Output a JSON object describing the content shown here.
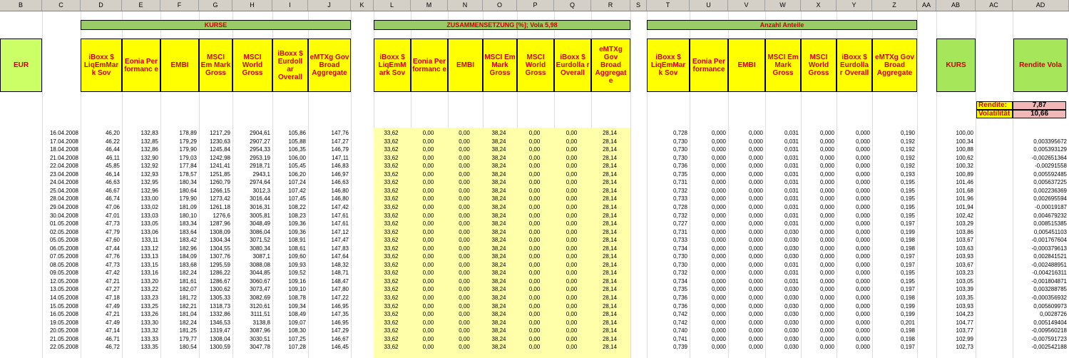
{
  "column_headers": [
    "B",
    "C",
    "D",
    "E",
    "F",
    "G",
    "H",
    "I",
    "J",
    "K",
    "L",
    "M",
    "N",
    "O",
    "P",
    "Q",
    "R",
    "S",
    "T",
    "U",
    "V",
    "W",
    "X",
    "Y",
    "Z",
    "AA",
    "AB",
    "AC",
    "AD"
  ],
  "bands": {
    "kurse": "KURSE",
    "zusammensetzung": "ZUSAMMENSETZUNG [%];   Vola 5,98",
    "anteile": "Anzahl Anteile"
  },
  "headers": {
    "eur": "EUR",
    "kurse": [
      "iBoxx $ LiqEmMar k Sov",
      "Eonia Per formanc e",
      "EMBI",
      "MSCI Em Mark Gross",
      "MSCI World Gross",
      "iBoxx $ Eurdoll ar Overall",
      "eMTXg Gov Broad Aggregate"
    ],
    "zusammensetzung": [
      "iBoxx $ LiqEmM ark Sov",
      "Eonia Per formanc e",
      "EMBI",
      "MSCI Em Mark Gross",
      "MSCI World Gross",
      "iBoxx $ Eurdolla r Overall",
      "eMTXg Gov Broad Aggregat e"
    ],
    "anteile": [
      "iBoxx $ LiqEmMar k Sov",
      "Eonia Per formance",
      "EMBI",
      "MSCI Em Mark Gross",
      "MSCI World Gross",
      "iBoxx $ Eurdolla r Overall",
      "eMTXg Gov Broad Aggregate"
    ],
    "kurs": "KURS",
    "rendite_vola": "Rendite Vola"
  },
  "summary": {
    "rendite_label": "Rendite:",
    "rendite_value": "7,87",
    "volatilitaet_label": "Volatilität",
    "volatilitaet_value": "10,66"
  },
  "rows": [
    [
      "16.04.2008",
      "46,20",
      "132,83",
      "178,89",
      "1217,29",
      "2904,61",
      "105,86",
      "147,76",
      "33,62",
      "0,00",
      "0,00",
      "38,24",
      "0,00",
      "0,00",
      "28,14",
      "0,728",
      "0,000",
      "0,000",
      "0,031",
      "0,000",
      "0,000",
      "0,190",
      "100,00",
      ""
    ],
    [
      "17.04.2008",
      "46,22",
      "132,85",
      "179,29",
      "1230,63",
      "2907,27",
      "105,88",
      "147,27",
      "33,62",
      "0,00",
      "0,00",
      "38,24",
      "0,00",
      "0,00",
      "28,14",
      "0,730",
      "0,000",
      "0,000",
      "0,031",
      "0,000",
      "0,000",
      "0,192",
      "100,34",
      "0,003395672"
    ],
    [
      "18.04.2008",
      "46,44",
      "132,86",
      "179,90",
      "1245,84",
      "2954,33",
      "106,35",
      "146,79",
      "33,62",
      "0,00",
      "0,00",
      "38,24",
      "0,00",
      "0,00",
      "28,14",
      "0,730",
      "0,000",
      "0,000",
      "0,031",
      "0,000",
      "0,000",
      "0,192",
      "100,88",
      "0,005393129"
    ],
    [
      "21.04.2008",
      "46,11",
      "132,90",
      "179,03",
      "1242,98",
      "2953,19",
      "106,00",
      "147,11",
      "33,62",
      "0,00",
      "0,00",
      "38,24",
      "0,00",
      "0,00",
      "28,14",
      "0,730",
      "0,000",
      "0,000",
      "0,031",
      "0,000",
      "0,000",
      "0,192",
      "100,62",
      "-0,002651364"
    ],
    [
      "22.04.2008",
      "45,85",
      "132,92",
      "177,84",
      "1241,41",
      "2918,71",
      "105,45",
      "146,83",
      "33,62",
      "0,00",
      "0,00",
      "38,24",
      "0,00",
      "0,00",
      "28,14",
      "0,736",
      "0,000",
      "0,000",
      "0,031",
      "0,000",
      "0,000",
      "0,192",
      "100,32",
      "-0,00291558"
    ],
    [
      "23.04.2008",
      "46,14",
      "132,93",
      "178,57",
      "1251,85",
      "2943,1",
      "106,20",
      "146,97",
      "33,62",
      "0,00",
      "0,00",
      "38,24",
      "0,00",
      "0,00",
      "28,14",
      "0,735",
      "0,000",
      "0,000",
      "0,031",
      "0,000",
      "0,000",
      "0,193",
      "100,89",
      "0,005592485"
    ],
    [
      "24.04.2008",
      "46,63",
      "132,95",
      "180,34",
      "1260,79",
      "2974,64",
      "107,24",
      "146,63",
      "33,62",
      "0,00",
      "0,00",
      "38,24",
      "0,00",
      "0,00",
      "28,14",
      "0,731",
      "0,000",
      "0,000",
      "0,031",
      "0,000",
      "0,000",
      "0,195",
      "101,46",
      "0,005637225"
    ],
    [
      "25.04.2008",
      "46,67",
      "132,96",
      "180,64",
      "1266,15",
      "3012,3",
      "107,42",
      "146,80",
      "33,62",
      "0,00",
      "0,00",
      "38,24",
      "0,00",
      "0,00",
      "28,14",
      "0,732",
      "0,000",
      "0,000",
      "0,031",
      "0,000",
      "0,000",
      "0,195",
      "101,68",
      "0,002236369"
    ],
    [
      "28.04.2008",
      "46,74",
      "133,00",
      "179,90",
      "1273,42",
      "3016,44",
      "107,45",
      "146,80",
      "33,62",
      "0,00",
      "0,00",
      "38,24",
      "0,00",
      "0,00",
      "28,14",
      "0,733",
      "0,000",
      "0,000",
      "0,031",
      "0,000",
      "0,000",
      "0,195",
      "101,96",
      "0,002695594"
    ],
    [
      "29.04.2008",
      "47,06",
      "133,02",
      "181,09",
      "1261,18",
      "3016,31",
      "108,22",
      "147,42",
      "33,62",
      "0,00",
      "0,00",
      "38,24",
      "0,00",
      "0,00",
      "28,14",
      "0,728",
      "0,000",
      "0,000",
      "0,031",
      "0,000",
      "0,000",
      "0,195",
      "101,94",
      "-0,00019187"
    ],
    [
      "30.04.2008",
      "47,01",
      "133,03",
      "180,10",
      "1276,6",
      "3005,81",
      "108,23",
      "147,61",
      "33,62",
      "0,00",
      "0,00",
      "38,24",
      "0,00",
      "0,00",
      "28,14",
      "0,732",
      "0,000",
      "0,000",
      "0,031",
      "0,000",
      "0,000",
      "0,195",
      "102,42",
      "0,004679232"
    ],
    [
      "01.05.2008",
      "47,73",
      "133,05",
      "183,34",
      "1287,96",
      "3048,49",
      "109,36",
      "147,61",
      "33,62",
      "0,00",
      "0,00",
      "38,24",
      "0,00",
      "0,00",
      "28,14",
      "0,727",
      "0,000",
      "0,000",
      "0,031",
      "0,000",
      "0,000",
      "0,197",
      "103,29",
      "0,008515385"
    ],
    [
      "02.05.2008",
      "47,79",
      "133,06",
      "183,64",
      "1308,09",
      "3086,04",
      "109,36",
      "147,12",
      "33,62",
      "0,00",
      "0,00",
      "38,24",
      "0,00",
      "0,00",
      "28,14",
      "0,731",
      "0,000",
      "0,000",
      "0,030",
      "0,000",
      "0,000",
      "0,199",
      "103,86",
      "0,005451103"
    ],
    [
      "05.05.2008",
      "47,60",
      "133,11",
      "183,42",
      "1304,34",
      "3071,52",
      "108,91",
      "147,47",
      "33,62",
      "0,00",
      "0,00",
      "38,24",
      "0,00",
      "0,00",
      "28,14",
      "0,733",
      "0,000",
      "0,000",
      "0,030",
      "0,000",
      "0,000",
      "0,198",
      "103,67",
      "-0,001767604"
    ],
    [
      "06.05.2008",
      "47,44",
      "133,12",
      "182,96",
      "1304,55",
      "3080,34",
      "108,61",
      "147,83",
      "33,62",
      "0,00",
      "0,00",
      "38,24",
      "0,00",
      "0,00",
      "28,14",
      "0,734",
      "0,000",
      "0,000",
      "0,030",
      "0,000",
      "0,000",
      "0,198",
      "103,63",
      "-0,000379613"
    ],
    [
      "07.05.2008",
      "47,76",
      "133,13",
      "184,09",
      "1307,76",
      "3087,1",
      "109,60",
      "147,64",
      "33,62",
      "0,00",
      "0,00",
      "38,24",
      "0,00",
      "0,00",
      "28,14",
      "0,730",
      "0,000",
      "0,000",
      "0,030",
      "0,000",
      "0,000",
      "0,197",
      "103,93",
      "0,002841521"
    ],
    [
      "08.05.2008",
      "47,73",
      "133,15",
      "183,68",
      "1295,59",
      "3088,08",
      "109,93",
      "148,32",
      "33,62",
      "0,00",
      "0,00",
      "38,24",
      "0,00",
      "0,00",
      "28,14",
      "0,730",
      "0,000",
      "0,000",
      "0,031",
      "0,000",
      "0,000",
      "0,197",
      "103,67",
      "-0,002488951"
    ],
    [
      "09.05.2008",
      "47,42",
      "133,16",
      "182,24",
      "1286,22",
      "3044,85",
      "109,52",
      "148,71",
      "33,62",
      "0,00",
      "0,00",
      "38,24",
      "0,00",
      "0,00",
      "28,14",
      "0,732",
      "0,000",
      "0,000",
      "0,031",
      "0,000",
      "0,000",
      "0,195",
      "103,23",
      "-0,004216311"
    ],
    [
      "12.05.2008",
      "47,21",
      "133,20",
      "181,61",
      "1286,67",
      "3060,67",
      "109,16",
      "148,47",
      "33,62",
      "0,00",
      "0,00",
      "38,24",
      "0,00",
      "0,00",
      "28,14",
      "0,734",
      "0,000",
      "0,000",
      "0,031",
      "0,000",
      "0,000",
      "0,195",
      "103,05",
      "-0,001804871"
    ],
    [
      "13.05.2008",
      "47,27",
      "133,22",
      "182,07",
      "1300,62",
      "3073,47",
      "109,10",
      "147,80",
      "33,62",
      "0,00",
      "0,00",
      "38,24",
      "0,00",
      "0,00",
      "28,14",
      "0,735",
      "0,000",
      "0,000",
      "0,030",
      "0,000",
      "0,000",
      "0,197",
      "103,39",
      "0,003288785"
    ],
    [
      "14.05.2008",
      "47,18",
      "133,23",
      "181,72",
      "1305,33",
      "3082,69",
      "108,78",
      "147,22",
      "33,62",
      "0,00",
      "0,00",
      "38,24",
      "0,00",
      "0,00",
      "28,14",
      "0,736",
      "0,000",
      "0,000",
      "0,030",
      "0,000",
      "0,000",
      "0,198",
      "103,35",
      "-0,000356932"
    ],
    [
      "15.05.2008",
      "47,49",
      "133,25",
      "182,21",
      "1318,73",
      "3120,61",
      "109,34",
      "146,95",
      "33,62",
      "0,00",
      "0,00",
      "38,24",
      "0,00",
      "0,00",
      "28,14",
      "0,736",
      "0,000",
      "0,000",
      "0,030",
      "0,000",
      "0,000",
      "0,199",
      "103,93",
      "0,005609973"
    ],
    [
      "16.05.2008",
      "47,21",
      "133,26",
      "181,04",
      "1332,86",
      "3111,51",
      "108,49",
      "147,35",
      "33,62",
      "0,00",
      "0,00",
      "38,24",
      "0,00",
      "0,00",
      "28,14",
      "0,742",
      "0,000",
      "0,000",
      "0,030",
      "0,000",
      "0,000",
      "0,199",
      "104,23",
      "0,0028726"
    ],
    [
      "19.05.2008",
      "47,49",
      "133,30",
      "182,24",
      "1346,53",
      "3138,8",
      "109,07",
      "146,95",
      "33,62",
      "0,00",
      "0,00",
      "38,24",
      "0,00",
      "0,00",
      "28,14",
      "0,742",
      "0,000",
      "0,000",
      "0,030",
      "0,000",
      "0,000",
      "0,201",
      "104,77",
      "0,005149404"
    ],
    [
      "20.05.2008",
      "47,14",
      "133,32",
      "181,25",
      "1319,47",
      "3087,96",
      "108,30",
      "147,29",
      "33,62",
      "0,00",
      "0,00",
      "38,24",
      "0,00",
      "0,00",
      "28,14",
      "0,740",
      "0,000",
      "0,000",
      "0,030",
      "0,000",
      "0,000",
      "0,198",
      "103,77",
      "-0,009560218"
    ],
    [
      "21.05.2008",
      "46,71",
      "133,33",
      "179,77",
      "1308,04",
      "3030,51",
      "107,25",
      "146,67",
      "33,62",
      "0,00",
      "0,00",
      "38,24",
      "0,00",
      "0,00",
      "28,14",
      "0,741",
      "0,000",
      "0,000",
      "0,030",
      "0,000",
      "0,000",
      "0,198",
      "102,99",
      "-0,007591723"
    ],
    [
      "22.05.2008",
      "46,72",
      "133,35",
      "180,54",
      "1300,59",
      "3047,78",
      "107,28",
      "146,45",
      "33,62",
      "0,00",
      "0,00",
      "38,24",
      "0,00",
      "0,00",
      "28,14",
      "0,739",
      "0,000",
      "0,000",
      "0,030",
      "0,000",
      "0,000",
      "0,197",
      "102,73",
      "-0,002542188"
    ]
  ]
}
